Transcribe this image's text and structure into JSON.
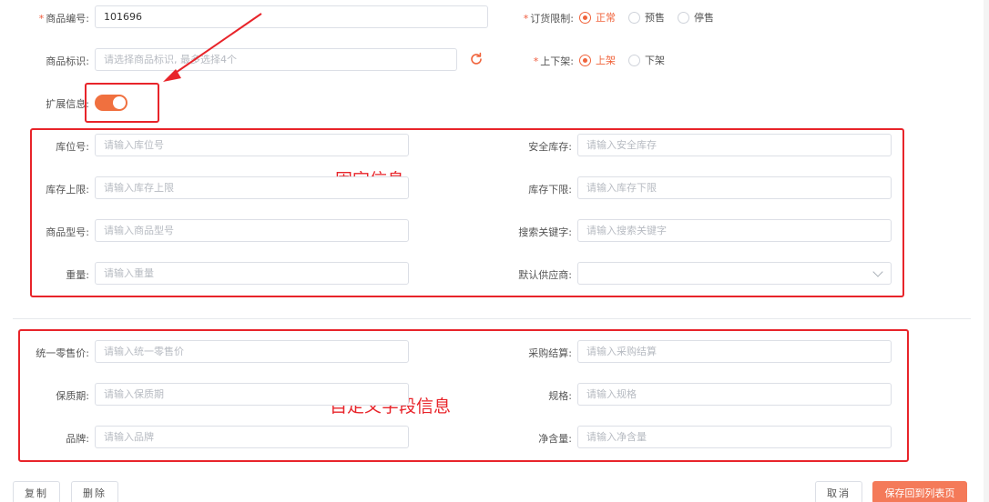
{
  "top": {
    "product_code": {
      "label": "商品编号:",
      "value": "101696"
    },
    "order_limit": {
      "label": "订货限制:",
      "options": [
        "正常",
        "预售",
        "停售"
      ],
      "selected": "正常"
    },
    "product_tag": {
      "label": "商品标识:",
      "placeholder": "请选择商品标识, 最多选择4个"
    },
    "shelf": {
      "label": "上下架:",
      "options": [
        "上架",
        "下架"
      ],
      "selected": "上架"
    },
    "extend_info": {
      "label": "扩展信息:",
      "enabled": true
    }
  },
  "fixed": {
    "annotation": "固定信息",
    "fields": [
      {
        "label": "库位号:",
        "placeholder": "请输入库位号"
      },
      {
        "label": "安全库存:",
        "placeholder": "请输入安全库存"
      },
      {
        "label": "库存上限:",
        "placeholder": "请输入库存上限"
      },
      {
        "label": "库存下限:",
        "placeholder": "请输入库存下限"
      },
      {
        "label": "商品型号:",
        "placeholder": "请输入商品型号"
      },
      {
        "label": "搜索关键字:",
        "placeholder": "请输入搜索关键字"
      },
      {
        "label": "重量:",
        "placeholder": "请输入重量"
      },
      {
        "label": "默认供应商:",
        "placeholder": ""
      }
    ]
  },
  "custom": {
    "annotation": "自定义字段信息",
    "fields": [
      {
        "label": "统一零售价:",
        "placeholder": "请输入统一零售价"
      },
      {
        "label": "采购结算:",
        "placeholder": "请输入采购结算"
      },
      {
        "label": "保质期:",
        "placeholder": "请输入保质期"
      },
      {
        "label": "规格:",
        "placeholder": "请输入规格"
      },
      {
        "label": "品牌:",
        "placeholder": "请输入品牌"
      },
      {
        "label": "净含量:",
        "placeholder": "请输入净含量"
      }
    ]
  },
  "footer": {
    "copy": "复制",
    "delete": "删除",
    "cancel": "取消",
    "save": "保存回到列表页"
  },
  "colors": {
    "accent": "#f0643c",
    "annotation": "#e8242a"
  }
}
